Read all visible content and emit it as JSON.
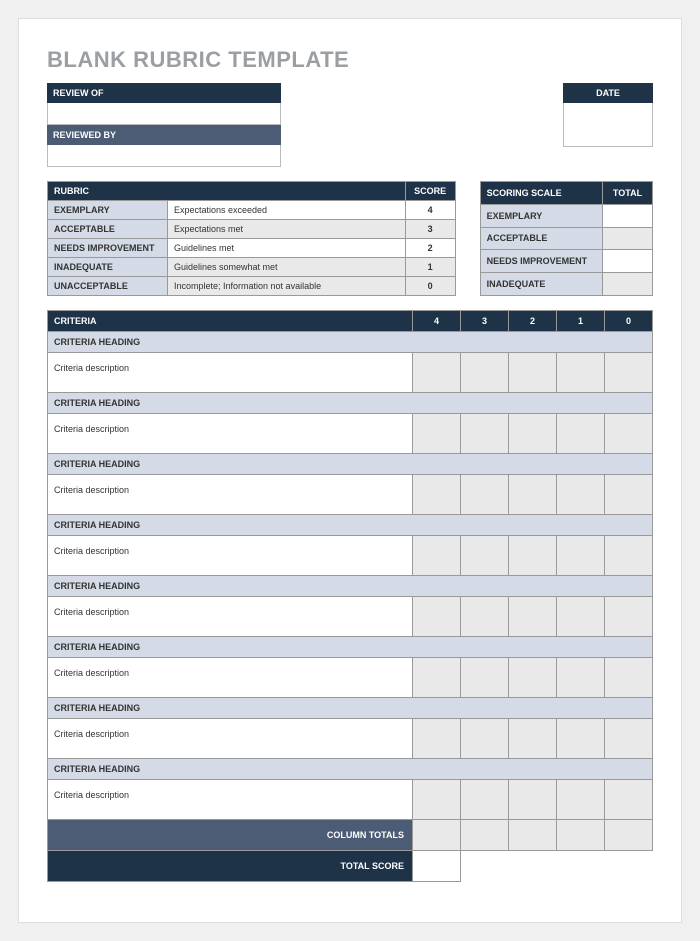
{
  "title": "BLANK RUBRIC TEMPLATE",
  "fields": {
    "review_of": "REVIEW OF",
    "reviewed_by": "REVIEWED BY",
    "date": "DATE"
  },
  "rubric": {
    "header_label": "RUBRIC",
    "score_label": "SCORE",
    "rows": [
      {
        "level": "EXEMPLARY",
        "desc": "Expectations exceeded",
        "score": "4"
      },
      {
        "level": "ACCEPTABLE",
        "desc": "Expectations met",
        "score": "3"
      },
      {
        "level": "NEEDS IMPROVEMENT",
        "desc": "Guidelines met",
        "score": "2"
      },
      {
        "level": "INADEQUATE",
        "desc": "Guidelines somewhat met",
        "score": "1"
      },
      {
        "level": "UNACCEPTABLE",
        "desc": "Incomplete; Information not available",
        "score": "0"
      }
    ]
  },
  "scoring": {
    "header_label": "SCORING SCALE",
    "total_label": "TOTAL",
    "rows": [
      {
        "level": "EXEMPLARY",
        "total": ""
      },
      {
        "level": "ACCEPTABLE",
        "total": ""
      },
      {
        "level": "NEEDS IMPROVEMENT",
        "total": ""
      },
      {
        "level": "INADEQUATE",
        "total": ""
      }
    ]
  },
  "criteria": {
    "header_label": "CRITERIA",
    "cols": [
      "4",
      "3",
      "2",
      "1",
      "0"
    ],
    "sections": [
      {
        "heading": "CRITERIA HEADING",
        "desc": "Criteria description"
      },
      {
        "heading": "CRITERIA HEADING",
        "desc": "Criteria description"
      },
      {
        "heading": "CRITERIA HEADING",
        "desc": "Criteria description"
      },
      {
        "heading": "CRITERIA HEADING",
        "desc": "Criteria description"
      },
      {
        "heading": "CRITERIA HEADING",
        "desc": "Criteria description"
      },
      {
        "heading": "CRITERIA HEADING",
        "desc": "Criteria description"
      },
      {
        "heading": "CRITERIA HEADING",
        "desc": "Criteria description"
      },
      {
        "heading": "CRITERIA HEADING",
        "desc": "Criteria description"
      }
    ],
    "column_totals_label": "COLUMN TOTALS",
    "total_score_label": "TOTAL SCORE"
  }
}
